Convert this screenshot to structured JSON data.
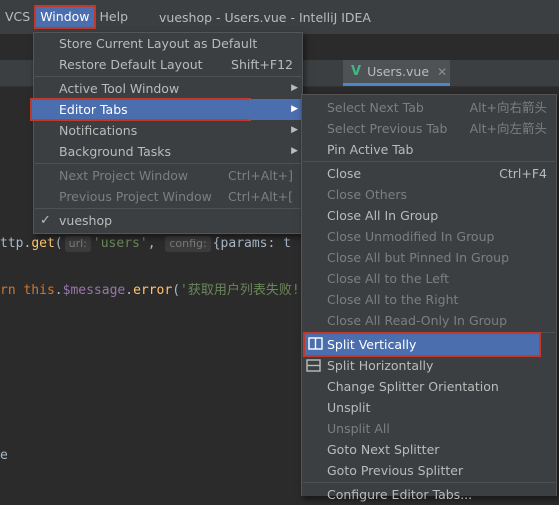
{
  "menubar": {
    "vcs": "VCS",
    "window": "Window",
    "help": "Help",
    "title": "vueshop - Users.vue - IntelliJ IDEA"
  },
  "editor_tab": {
    "name": "Users.vue",
    "icon": "vue-icon"
  },
  "code": {
    "line1": {
      "a": "ttp.",
      "b": "get",
      "c": "(",
      "hint1": "url:",
      "s1": "'users'",
      "d": ",",
      "hint2": "config:",
      "e": "{params: t"
    },
    "line2": {
      "a": "rn ",
      "b": "this",
      "c": ".",
      "d": "$message",
      "e": ".",
      "f": "error",
      "g": "(",
      "s": "'获取用户列表失败!"
    },
    "line3": "e"
  },
  "window_menu": {
    "items": [
      {
        "label": "Store Current Layout as Default",
        "shortcut": ""
      },
      {
        "label": "Restore Default Layout",
        "shortcut": "Shift+F12"
      },
      {
        "label": "Active Tool Window",
        "shortcut": ""
      },
      {
        "label": "Editor Tabs",
        "shortcut": ""
      },
      {
        "label": "Notifications",
        "shortcut": ""
      },
      {
        "label": "Background Tasks",
        "shortcut": ""
      },
      {
        "label": "Next Project Window",
        "shortcut": "Ctrl+Alt+]"
      },
      {
        "label": "Previous Project Window",
        "shortcut": "Ctrl+Alt+["
      },
      {
        "label": "vueshop",
        "shortcut": ""
      }
    ]
  },
  "tabs_menu": {
    "items": [
      {
        "label": "Select Next Tab",
        "shortcut": "Alt+向右箭头"
      },
      {
        "label": "Select Previous Tab",
        "shortcut": "Alt+向左箭头"
      },
      {
        "label": "Pin Active Tab",
        "shortcut": ""
      },
      {
        "label": "Close",
        "shortcut": "Ctrl+F4"
      },
      {
        "label": "Close Others",
        "shortcut": ""
      },
      {
        "label": "Close All In Group",
        "shortcut": ""
      },
      {
        "label": "Close Unmodified In Group",
        "shortcut": ""
      },
      {
        "label": "Close All but Pinned In Group",
        "shortcut": ""
      },
      {
        "label": "Close All to the Left",
        "shortcut": ""
      },
      {
        "label": "Close All to the Right",
        "shortcut": ""
      },
      {
        "label": "Close All Read-Only In Group",
        "shortcut": ""
      },
      {
        "label": "Split Vertically",
        "shortcut": ""
      },
      {
        "label": "Split Horizontally",
        "shortcut": ""
      },
      {
        "label": "Change Splitter Orientation",
        "shortcut": ""
      },
      {
        "label": "Unsplit",
        "shortcut": ""
      },
      {
        "label": "Unsplit All",
        "shortcut": ""
      },
      {
        "label": "Goto Next Splitter",
        "shortcut": ""
      },
      {
        "label": "Goto Previous Splitter",
        "shortcut": ""
      },
      {
        "label": "Configure Editor Tabs...",
        "shortcut": ""
      }
    ]
  },
  "colors": {
    "highlight": "#4b6eaf",
    "menu_bg": "#3c3f41",
    "editor_bg": "#2b2b2b",
    "annotation_box": "#c0392b",
    "vue_green": "#41b883"
  }
}
